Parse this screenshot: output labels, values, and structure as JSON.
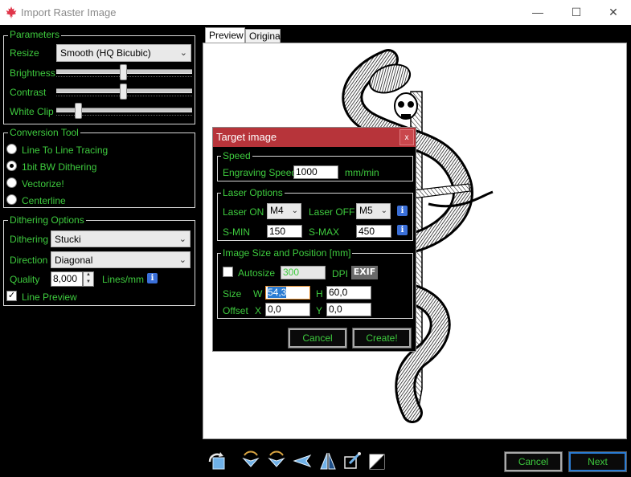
{
  "window": {
    "title": "Import Raster Image",
    "minimize_glyph": "—",
    "maximize_glyph": "☐",
    "close_glyph": "✕",
    "app_icon": "maple-leaf-icon",
    "accent_color": "#3ecb3e"
  },
  "parameters": {
    "group_title": "Parameters",
    "resize_label": "Resize",
    "resize_value": "Smooth (HQ Bicubic)",
    "brightness_label": "Brightness",
    "brightness_level": 0.5,
    "contrast_label": "Contrast",
    "contrast_level": 0.5,
    "whiteclip_label": "White Clip",
    "whiteclip_level": 0.16
  },
  "conversion_tool": {
    "group_title": "Conversion Tool",
    "options": [
      {
        "label": "Line To Line Tracing",
        "selected": false
      },
      {
        "label": "1bit BW Dithering",
        "selected": true
      },
      {
        "label": "Vectorize!",
        "selected": false
      },
      {
        "label": "Centerline",
        "selected": false
      }
    ]
  },
  "dithering": {
    "group_title": "Dithering Options",
    "dithering_label": "Dithering",
    "dithering_value": "Stucki",
    "direction_label": "Direction",
    "direction_value": "Diagonal",
    "quality_label": "Quality",
    "quality_value": "8,000",
    "quality_unit": "Lines/mm",
    "line_preview_label": "Line Preview",
    "line_preview_checked": true,
    "info_glyph": "i"
  },
  "tabs": [
    {
      "label": "Preview",
      "active": true
    },
    {
      "label": "Original",
      "active": false
    }
  ],
  "toolbar_icons": [
    "rotate-icon",
    "flip-left-icon",
    "flip-right-icon",
    "mirror-horizontal-icon",
    "mirror-vertical-icon",
    "crop-icon",
    "invert-icon"
  ],
  "footer": {
    "cancel_label": "Cancel",
    "next_label": "Next"
  },
  "dialog": {
    "title": "Target image",
    "close_glyph": "x",
    "speed": {
      "group_title": "Speed",
      "label": "Engraving Speed",
      "value": "1000",
      "unit": "mm/min"
    },
    "laser": {
      "group_title": "Laser Options",
      "laser_on_label": "Laser ON",
      "laser_on_value": "M4",
      "laser_off_label": "Laser OFF",
      "laser_off_value": "M5",
      "smin_label": "S-MIN",
      "smin_value": "150",
      "smax_label": "S-MAX",
      "smax_value": "450"
    },
    "image_size": {
      "group_title": "Image Size and Position [mm]",
      "autosize_label": "Autosize",
      "dpi_value": "300",
      "dpi_label": "DPI",
      "exif_label": "EXIF",
      "size_label": "Size",
      "w_label": "W",
      "w_value": "54,3",
      "h_label": "H",
      "h_value": "60,0",
      "offset_label": "Offset",
      "x_label": "X",
      "x_value": "0,0",
      "y_label": "Y",
      "y_value": "0,0"
    },
    "cancel_label": "Cancel",
    "create_label": "Create!"
  }
}
